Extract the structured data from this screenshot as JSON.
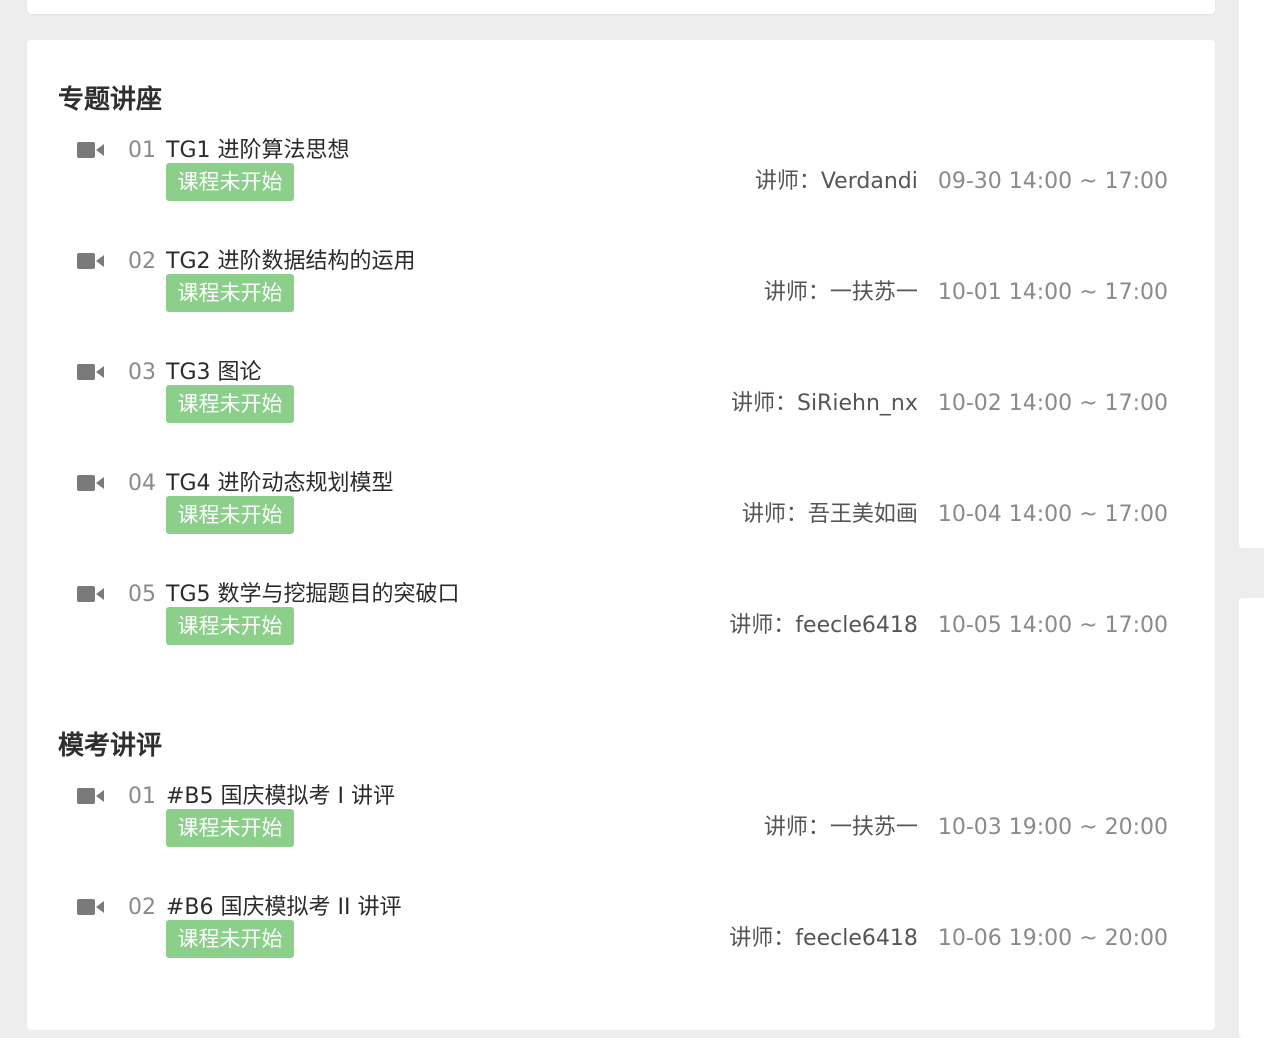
{
  "sections": [
    {
      "title": "专题讲座",
      "lessons": [
        {
          "num": "01",
          "title": "TG1 进阶算法思想",
          "status": "课程未开始",
          "teacher": "讲师：Verdandi",
          "time": "09-30 14:00 ~ 17:00"
        },
        {
          "num": "02",
          "title": "TG2 进阶数据结构的运用",
          "status": "课程未开始",
          "teacher": "讲师：一扶苏一",
          "time": "10-01 14:00 ~ 17:00"
        },
        {
          "num": "03",
          "title": "TG3 图论",
          "status": "课程未开始",
          "teacher": "讲师：SiRiehn_nx",
          "time": "10-02 14:00 ~ 17:00"
        },
        {
          "num": "04",
          "title": "TG4 进阶动态规划模型",
          "status": "课程未开始",
          "teacher": "讲师：吾王美如画",
          "time": "10-04 14:00 ~ 17:00"
        },
        {
          "num": "05",
          "title": "TG5 数学与挖掘题目的突破口",
          "status": "课程未开始",
          "teacher": "讲师：feecle6418",
          "time": "10-05 14:00 ~ 17:00"
        }
      ]
    },
    {
      "title": "模考讲评",
      "lessons": [
        {
          "num": "01",
          "title": "#B5 国庆模拟考 I 讲评",
          "status": "课程未开始",
          "teacher": "讲师：一扶苏一",
          "time": "10-03 19:00 ~ 20:00"
        },
        {
          "num": "02",
          "title": "#B6 国庆模拟考 II 讲评",
          "status": "课程未开始",
          "teacher": "讲师：feecle6418",
          "time": "10-06 19:00 ~ 20:00"
        }
      ]
    }
  ],
  "icons": {
    "lesson": "video-camera-icon"
  },
  "colors": {
    "status_badge": "#8bcf8b",
    "icon": "#7a7a7a",
    "page_bg": "#ededed"
  }
}
